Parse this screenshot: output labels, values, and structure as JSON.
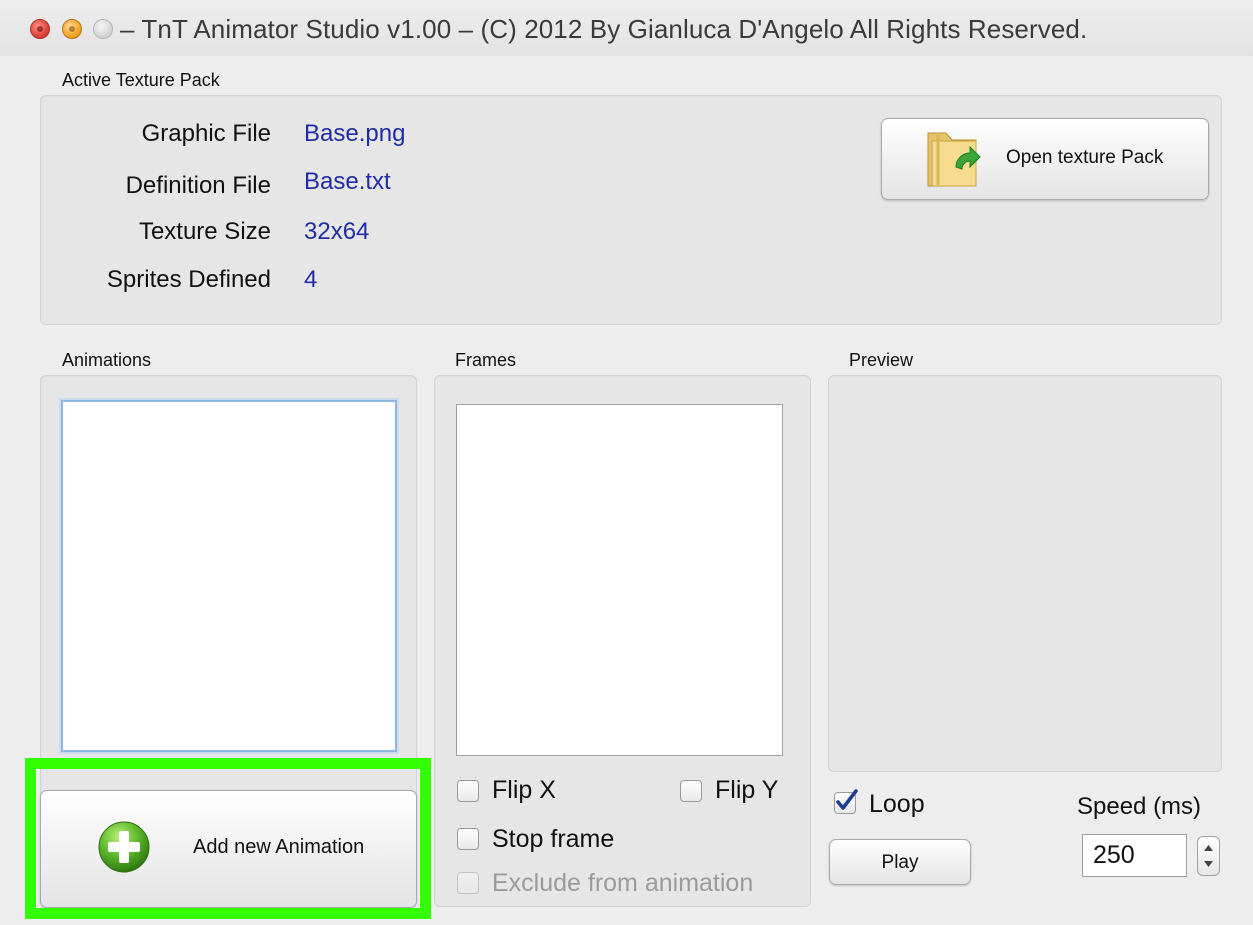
{
  "window": {
    "title": "– TnT Animator Studio v1.00 – (C) 2012 By Gianluca D'Angelo All Rights Reserved."
  },
  "texture_pack": {
    "group_label": "Active Texture Pack",
    "rows": [
      {
        "label": "Graphic File",
        "value": "Base.png"
      },
      {
        "label": "Definition File",
        "value": "Base.txt"
      },
      {
        "label": "Texture Size",
        "value": "32x64"
      },
      {
        "label": "Sprites Defined",
        "value": "4"
      }
    ],
    "open_button_label": "Open texture Pack"
  },
  "animations": {
    "group_label": "Animations",
    "add_button_label": "Add new Animation"
  },
  "frames": {
    "group_label": "Frames",
    "flip_x": "Flip X",
    "flip_y": "Flip Y",
    "stop_frame": "Stop frame",
    "exclude": "Exclude from animation"
  },
  "preview": {
    "group_label": "Preview",
    "loop_label": "Loop",
    "loop_checked": true,
    "speed_label": "Speed (ms)",
    "speed_value": "250",
    "play_label": "Play"
  },
  "colors": {
    "value_text": "#1f2da5",
    "highlight": "#33ff00",
    "checkbox_check": "#1e3a8c"
  }
}
